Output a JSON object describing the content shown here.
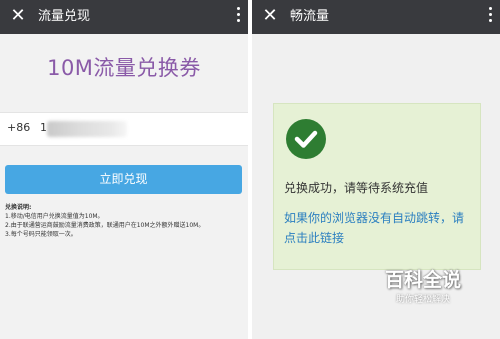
{
  "left": {
    "title": "流量兑现",
    "heading": "10M流量兑换券",
    "phone": {
      "prefix": "+86",
      "value_visible": "1"
    },
    "redeem_button": "立即兑现",
    "notes": {
      "title": "兑换说明:",
      "items": [
        "1.移动/电信用户兑换流量值为10M。",
        "2.由于联通营运商鼓励流量消费政策，联通用户在10M之外额外赠送10M。",
        "3.每个号码只能领取一次。"
      ]
    }
  },
  "right": {
    "title": "畅流量",
    "success_message": "兑换成功，请等待系统充值",
    "link_text": "如果你的浏览器没有自动跳转，请点击此链接"
  },
  "watermark": {
    "main": "百科全说",
    "sub": "助你轻松解决"
  },
  "icons": {
    "close": "close-icon",
    "more": "more-vertical-icon",
    "success": "checkmark-circle-icon"
  },
  "colors": {
    "titlebar": "#393a3e",
    "heading": "#8a5aa8",
    "button": "#47a7e3",
    "card": "#e6f1d5",
    "check": "#2e7d32",
    "link": "#2b7fc0"
  }
}
